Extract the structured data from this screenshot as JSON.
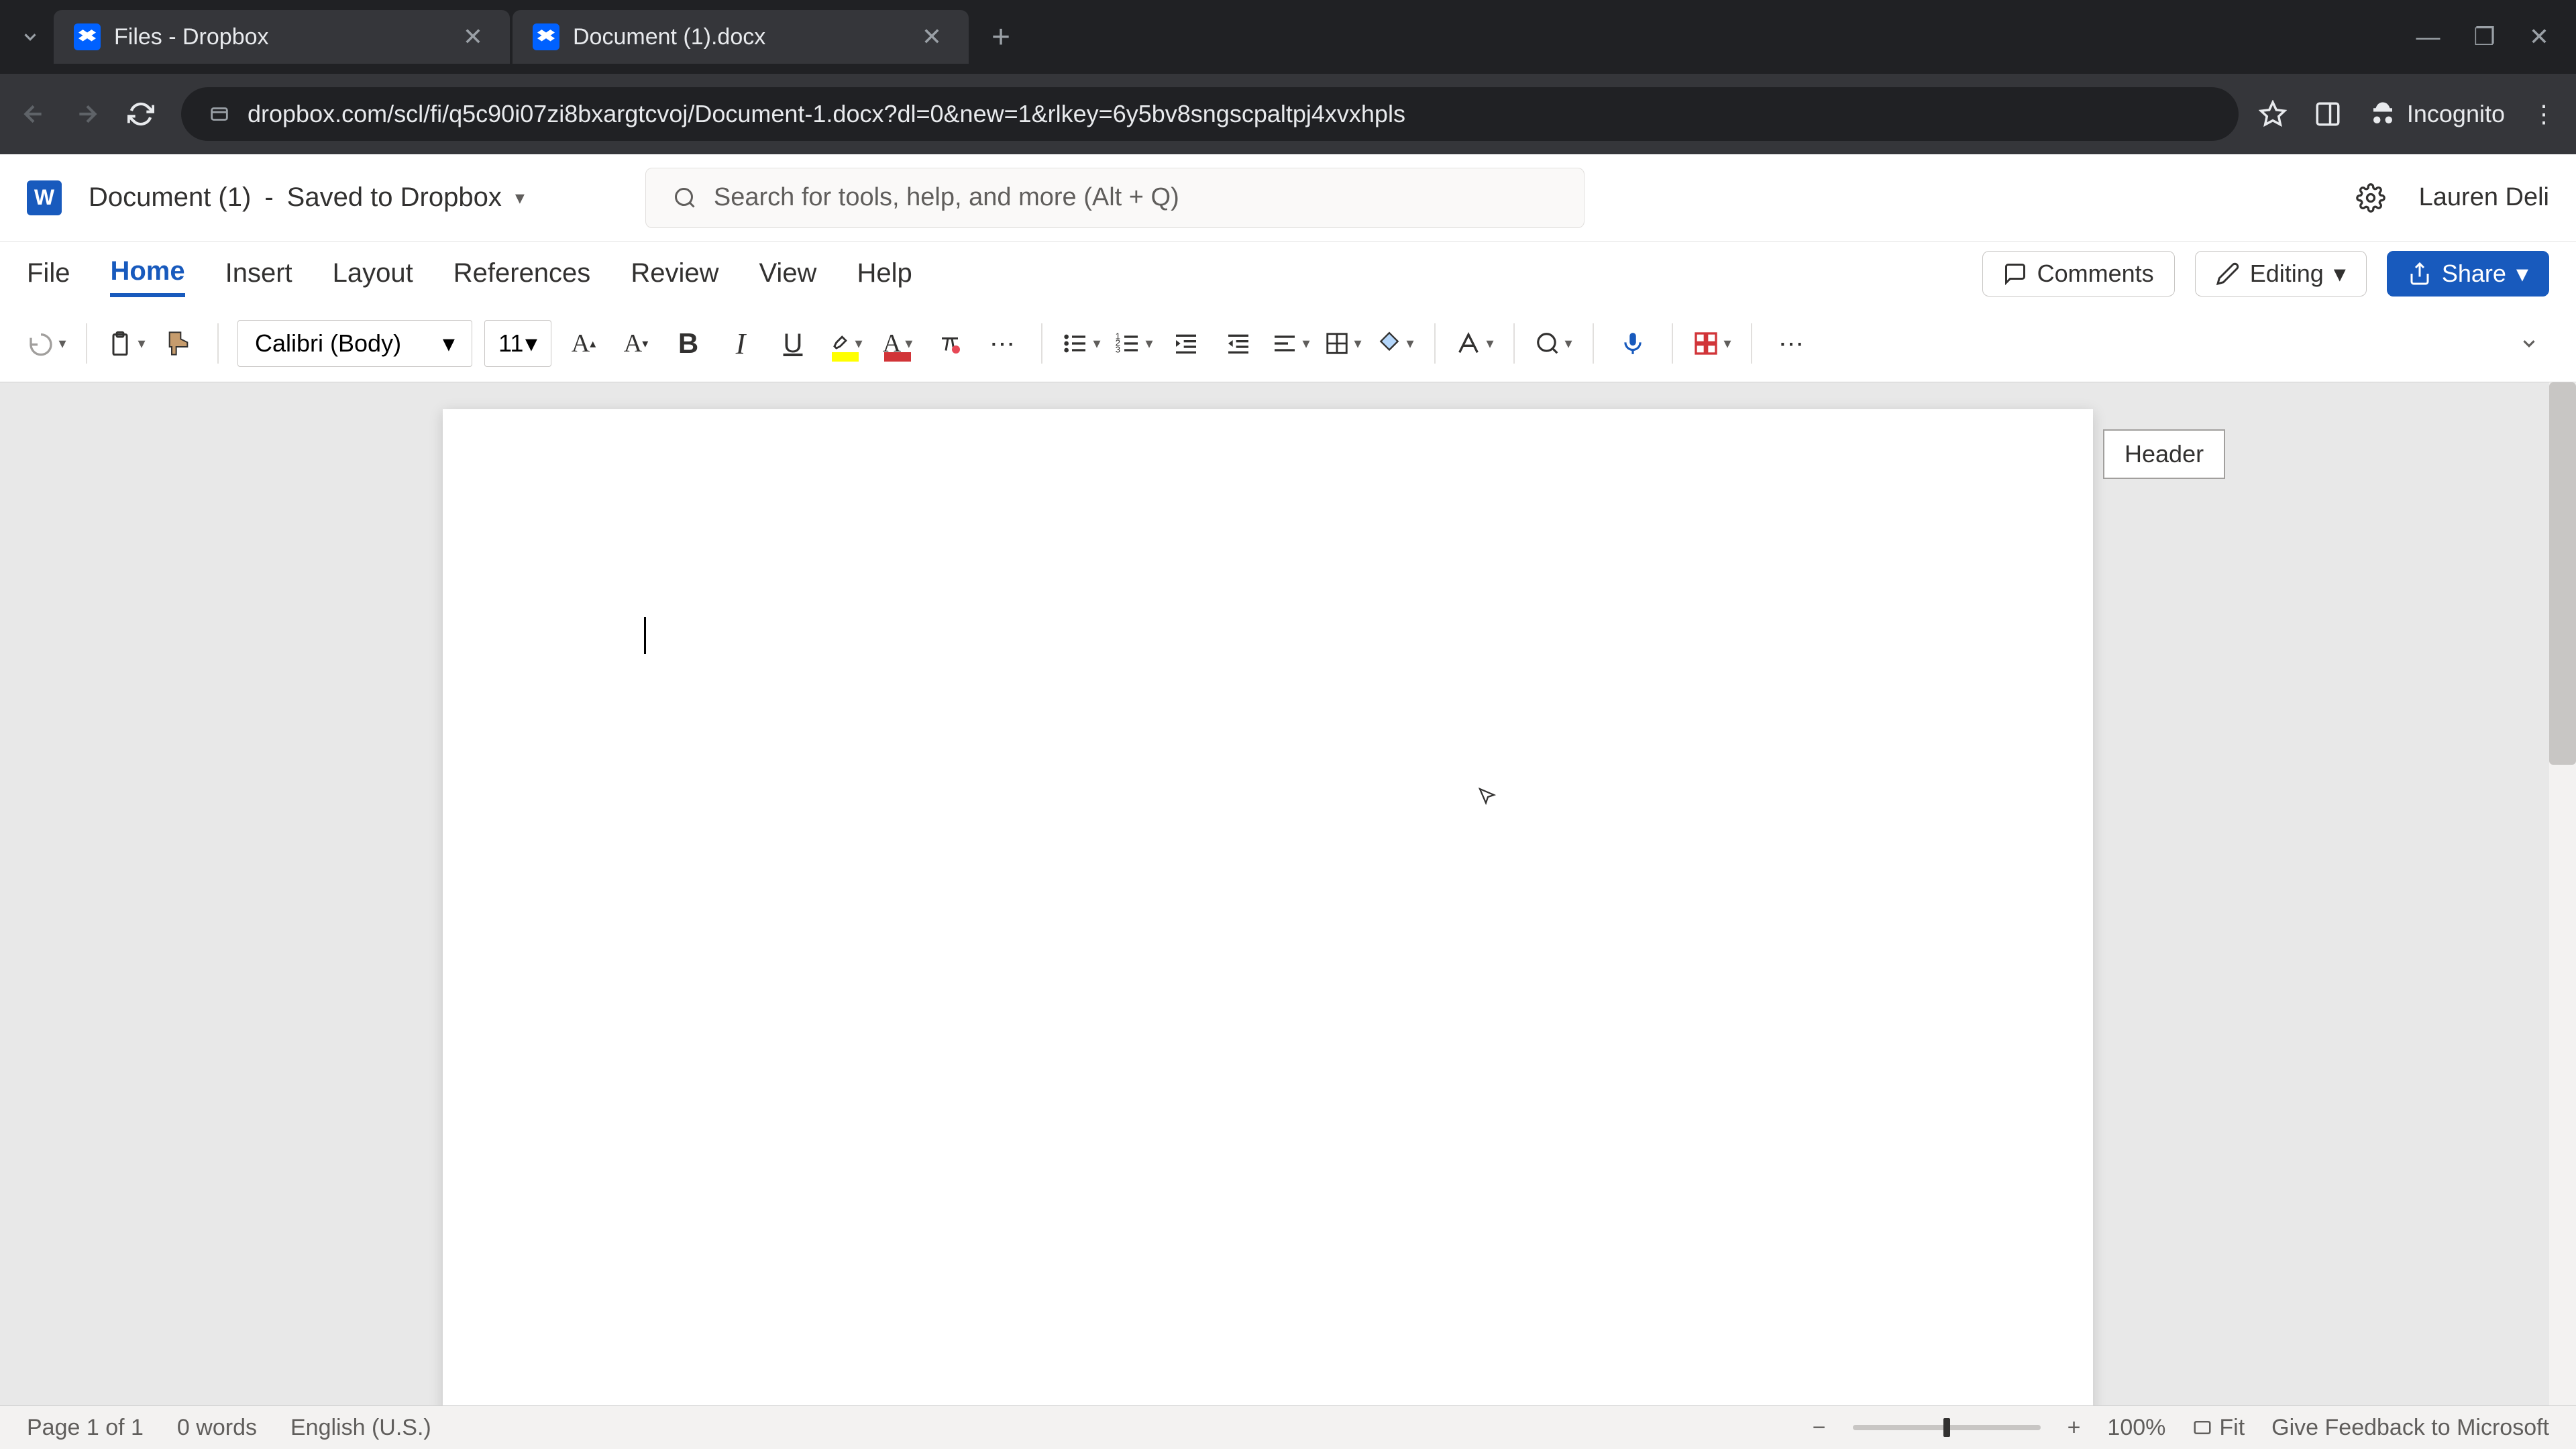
{
  "browser": {
    "tabs": [
      {
        "title": "Files - Dropbox",
        "active": false
      },
      {
        "title": "Document (1).docx",
        "active": true
      }
    ],
    "url": "dropbox.com/scl/fi/q5c90i07zi8bxargtcvoj/Document-1.docx?dl=0&new=1&rlkey=6y5bv8sngscpaltpj4xvxhpls",
    "incognito_label": "Incognito"
  },
  "app": {
    "icon_letter": "W",
    "doc_name": "Document (1)",
    "save_status": "Saved to Dropbox",
    "search_placeholder": "Search for tools, help, and more (Alt + Q)",
    "user_name": "Lauren Deli"
  },
  "ribbon": {
    "tabs": [
      "File",
      "Home",
      "Insert",
      "Layout",
      "References",
      "Review",
      "View",
      "Help"
    ],
    "active_tab": "Home",
    "comments_label": "Comments",
    "editing_label": "Editing",
    "share_label": "Share"
  },
  "toolbar": {
    "font_name": "Calibri (Body)",
    "font_size": "11"
  },
  "document": {
    "header_badge": "Header"
  },
  "status": {
    "page_info": "Page 1 of 1",
    "word_count": "0 words",
    "language": "English (U.S.)",
    "zoom_percent": "100%",
    "fit_label": "Fit",
    "feedback_label": "Give Feedback to Microsoft"
  }
}
